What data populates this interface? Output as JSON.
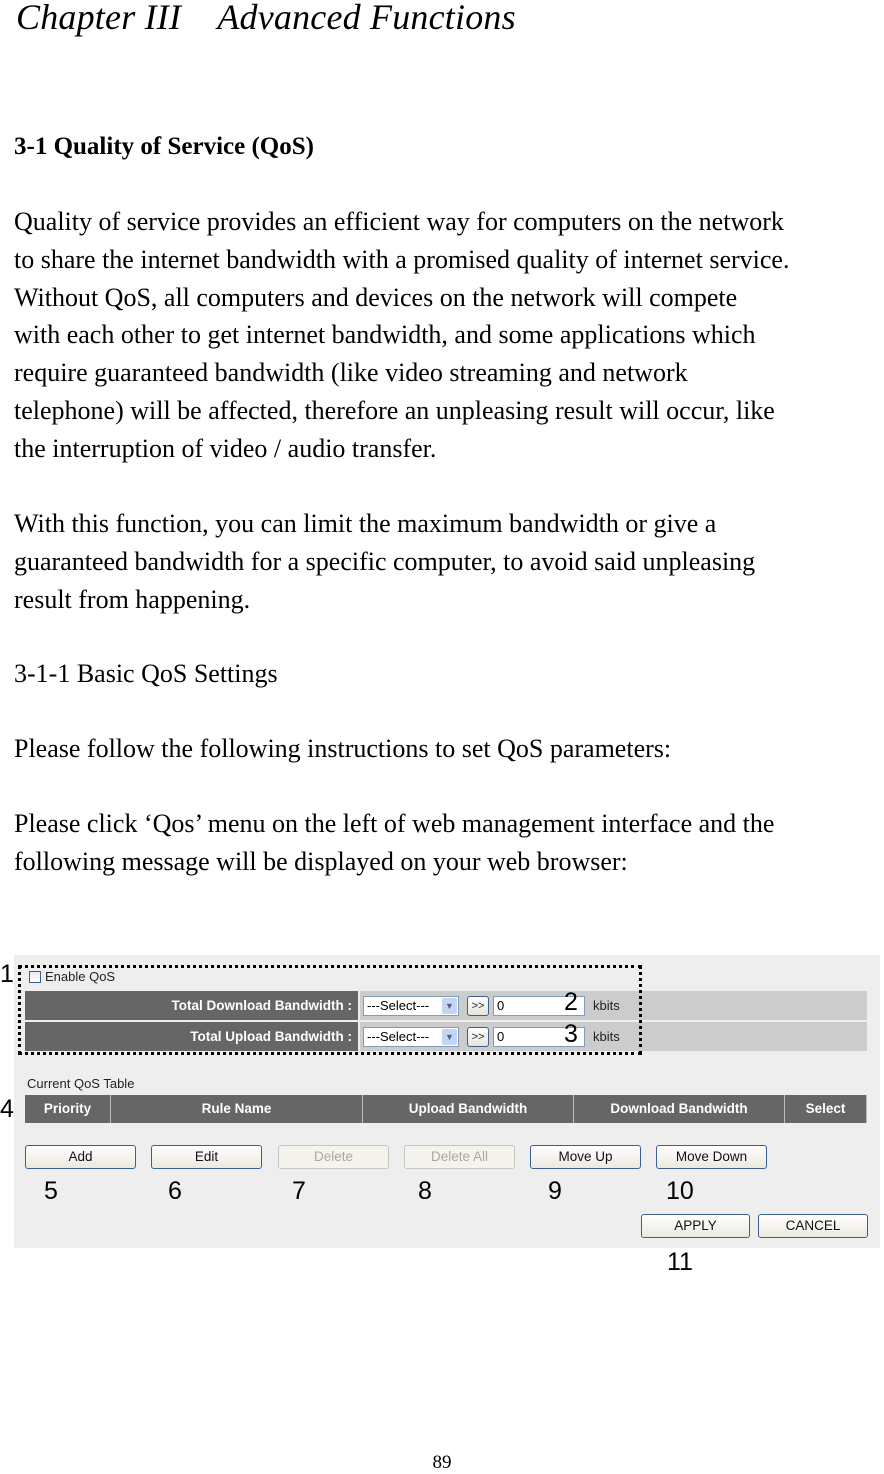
{
  "chapter_title": "Chapter III    Advanced Functions",
  "section_heading": "3-1 Quality of Service (QoS)",
  "paragraph1": [
    "Quality of service provides an efficient way for computers on the network",
    "to share the internet bandwidth with a promised quality of internet service.",
    "Without QoS, all computers and devices on the network will compete",
    "with each other to get internet bandwidth, and some applications which",
    "require guaranteed bandwidth (like video streaming and network",
    "telephone) will be affected, therefore an unpleasing result will occur, like",
    "the interruption of video / audio transfer."
  ],
  "paragraph2": [
    "With this function, you can limit the maximum bandwidth or give a",
    "guaranteed bandwidth for a specific computer, to avoid said unpleasing",
    "result from happening."
  ],
  "subsection_heading": "3-1-1 Basic QoS Settings",
  "instruction1": "Please follow the following instructions to set QoS parameters:",
  "instruction2": [
    "Please click ‘Qos’ menu on the left of web management interface and the",
    "following message will be displayed on your web browser:"
  ],
  "ui": {
    "enable_qos_label": "Enable QoS",
    "enable_qos_checked": false,
    "download": {
      "label": "Total Download Bandwidth :",
      "select_value": "---Select---",
      "go_label": ">>",
      "value": "0",
      "unit": "kbits"
    },
    "upload": {
      "label": "Total Upload Bandwidth :",
      "select_value": "---Select---",
      "go_label": ">>",
      "value": "0",
      "unit": "kbits"
    },
    "table_title": "Current QoS Table",
    "table_columns": [
      "Priority",
      "Rule Name",
      "Upload Bandwidth",
      "Download Bandwidth",
      "Select"
    ],
    "buttons": {
      "add": "Add",
      "edit": "Edit",
      "delete": "Delete",
      "delete_all": "Delete All",
      "move_up": "Move Up",
      "move_down": "Move Down",
      "apply": "APPLY",
      "cancel": "CANCEL"
    }
  },
  "callouts": [
    "1",
    "2",
    "3",
    "4",
    "5",
    "6",
    "7",
    "8",
    "9",
    "10",
    "11"
  ],
  "page_number": "89",
  "colors": {
    "panel_bg": "#eeeeee",
    "header_bg": "#666666",
    "control_bg": "#cccccc",
    "button_border": "#3c5f8e"
  }
}
